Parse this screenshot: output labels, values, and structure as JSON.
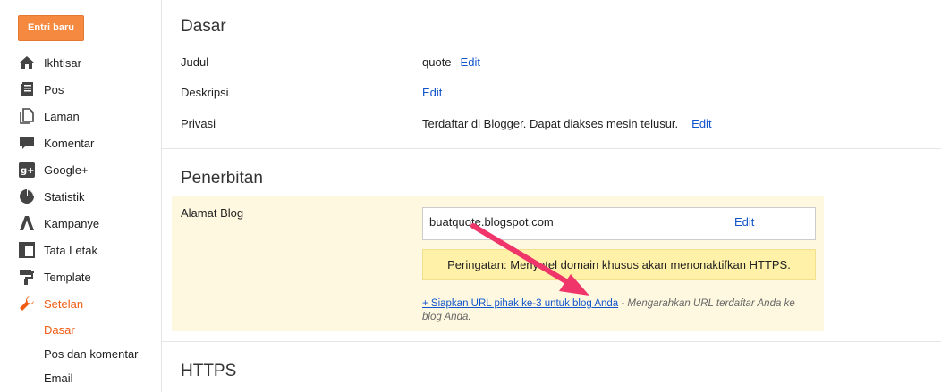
{
  "sidebar": {
    "new_post": "Entri baru",
    "items": [
      {
        "label": "Ikhtisar",
        "icon": "home-icon"
      },
      {
        "label": "Pos",
        "icon": "posts-icon"
      },
      {
        "label": "Laman",
        "icon": "pages-icon"
      },
      {
        "label": "Komentar",
        "icon": "comment-icon"
      },
      {
        "label": "Google+",
        "icon": "google-plus-icon"
      },
      {
        "label": "Statistik",
        "icon": "stats-icon"
      },
      {
        "label": "Kampanye",
        "icon": "campaign-icon"
      },
      {
        "label": "Tata Letak",
        "icon": "layout-icon"
      },
      {
        "label": "Template",
        "icon": "template-icon"
      },
      {
        "label": "Setelan",
        "icon": "wrench-icon"
      }
    ],
    "subitems": [
      {
        "label": "Dasar"
      },
      {
        "label": "Pos dan komentar"
      },
      {
        "label": "Email"
      }
    ]
  },
  "basic": {
    "title": "Dasar",
    "title_label": "Judul",
    "title_value": "quote",
    "description_label": "Deskripsi",
    "privacy_label": "Privasi",
    "privacy_value": "Terdaftar di Blogger. Dapat diakses mesin telusur.",
    "edit": "Edit"
  },
  "publishing": {
    "title": "Penerbitan",
    "address_label": "Alamat Blog",
    "address_value": "buatquote.blogspot.com",
    "edit": "Edit",
    "warning": "Peringatan: Menyetel domain khusus akan menonaktifkan HTTPS.",
    "third_party_link": "+ Siapkan URL pihak ke-3 untuk blog Anda",
    "third_party_note": " - Mengarahkan URL terdaftar Anda ke blog Anda."
  },
  "https": {
    "title": "HTTPS"
  },
  "colors": {
    "accent": "#f05c14",
    "link": "#1155cc",
    "button": "#f4893f",
    "highlight_bg": "#fff8e0",
    "warning_bg": "#fff1a8",
    "arrow": "#f0356b"
  }
}
